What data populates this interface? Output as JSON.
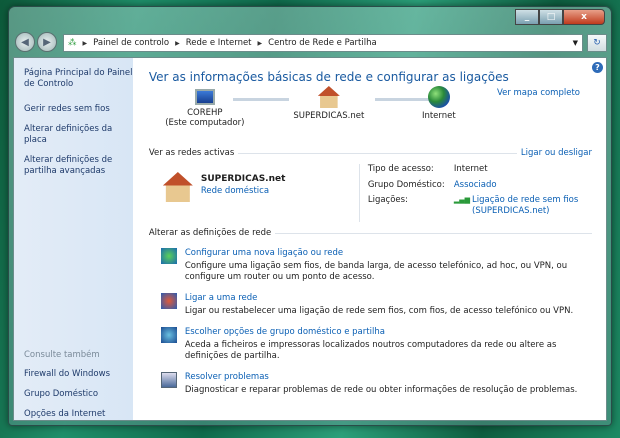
{
  "breadcrumb": [
    "Painel de controlo",
    "Rede e Internet",
    "Centro de Rede e Partilha"
  ],
  "sidebar": {
    "links": [
      "Página Principal do Painel de Controlo",
      "Gerir redes sem fios",
      "Alterar definições da placa",
      "Alterar definições de partilha avançadas"
    ],
    "see_also_title": "Consulte também",
    "see_also": [
      "Firewall do Windows",
      "Grupo Doméstico",
      "Opções da Internet"
    ]
  },
  "main": {
    "title": "Ver as informações básicas de rede e configurar as ligações",
    "full_map": "Ver mapa completo",
    "nodes": {
      "computer": "COREHP",
      "computer_sub": "(Este computador)",
      "network": "SUPERDICAS.net",
      "internet": "Internet"
    },
    "active_title": "Ver as redes activas",
    "connect_link": "Ligar ou desligar",
    "network_name": "SUPERDICAS.net",
    "network_type": "Rede doméstica",
    "access_label": "Tipo de acesso:",
    "access_value": "Internet",
    "homegroup_label": "Grupo Doméstico:",
    "homegroup_value": "Associado",
    "connections_label": "Ligações:",
    "connection_value": "Ligação de rede sem fios (SUPERDICAS.net)",
    "change_title": "Alterar as definições de rede",
    "tasks": [
      {
        "title": "Configurar uma nova ligação ou rede",
        "desc": "Configure uma ligação sem fios, de banda larga, de acesso telefónico, ad hoc, ou VPN, ou configure um router ou um ponto de acesso."
      },
      {
        "title": "Ligar a uma rede",
        "desc": "Ligar ou restabelecer uma ligação de rede sem fios, com fios, de acesso telefónico ou VPN."
      },
      {
        "title": "Escolher opções de grupo doméstico e partilha",
        "desc": "Aceda a ficheiros e impressoras localizados noutros computadores da rede ou altere as definições de partilha."
      },
      {
        "title": "Resolver problemas",
        "desc": "Diagnosticar e reparar problemas de rede ou obter informações de resolução de problemas."
      }
    ]
  }
}
